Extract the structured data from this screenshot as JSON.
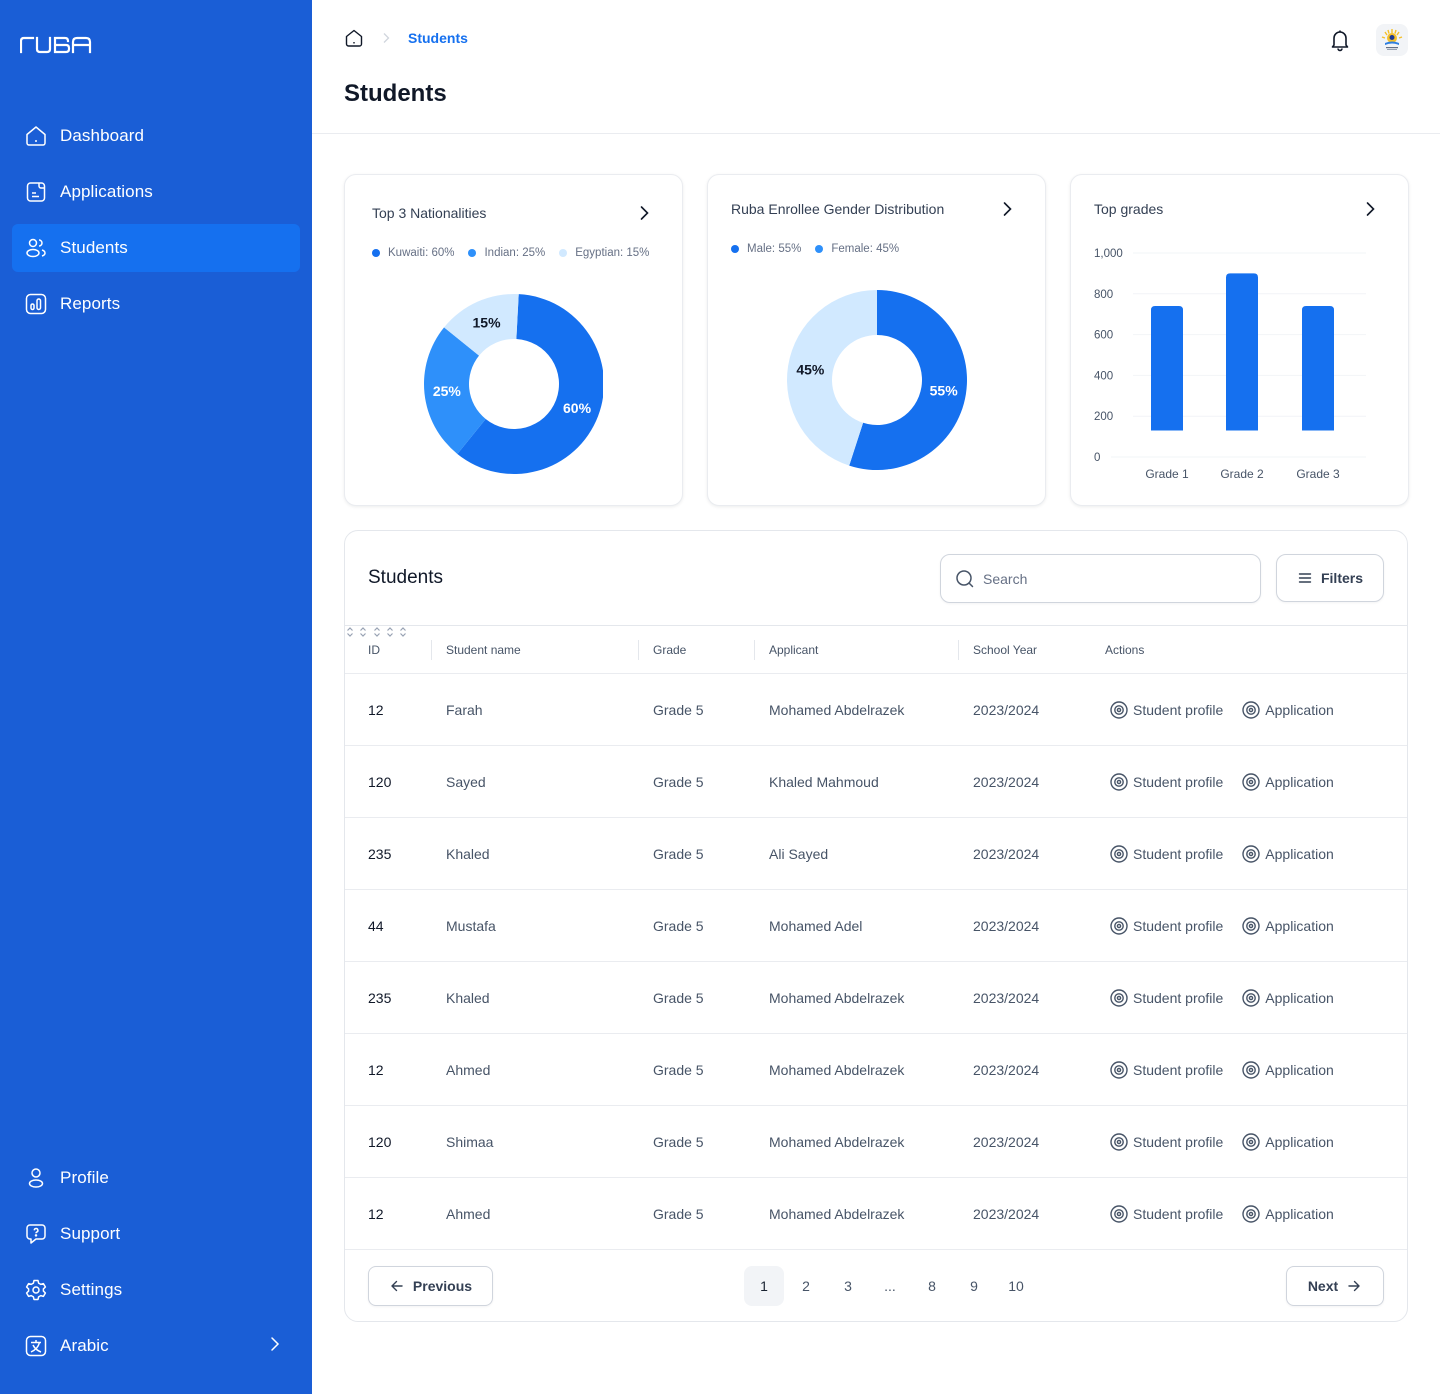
{
  "brand": {
    "logo_text": "ruba"
  },
  "sidebar": {
    "items": [
      {
        "label": "Dashboard",
        "icon": "home-icon",
        "active": false
      },
      {
        "label": "Applications",
        "icon": "document-icon",
        "active": false
      },
      {
        "label": "Students",
        "icon": "users-icon",
        "active": true
      },
      {
        "label": "Reports",
        "icon": "bar-chart-icon",
        "active": false
      }
    ],
    "bottom_items": [
      {
        "label": "Profile",
        "icon": "user-icon"
      },
      {
        "label": "Support",
        "icon": "help-message-icon"
      },
      {
        "label": "Settings",
        "icon": "gear-icon"
      },
      {
        "label": "Arabic",
        "icon": "translate-icon"
      }
    ],
    "colors": {
      "background": "#1a5ed6",
      "active": "#1570ef"
    }
  },
  "header": {
    "breadcrumb": {
      "home_icon": "home-icon",
      "current": "Students"
    },
    "title": "Students",
    "notification_icon": "bell-icon",
    "avatar_alt": "School logo"
  },
  "cards": {
    "nationalities": {
      "title": "Top 3 Nationalities",
      "legend": [
        "Kuwaiti: 60%",
        "Indian: 25%",
        "Egyptian: 15%"
      ]
    },
    "gender": {
      "title": "Ruba Enrollee Gender Distribution",
      "legend": [
        "Male: 55%",
        "Female: 45%"
      ]
    },
    "grades": {
      "title": "Top grades"
    }
  },
  "chart_data": [
    {
      "type": "pie",
      "title": "Top 3 Nationalities",
      "categories": [
        "Kuwaiti",
        "Indian",
        "Egyptian"
      ],
      "values": [
        60,
        25,
        15
      ],
      "labels": [
        "60%",
        "25%",
        "15%"
      ],
      "colors": [
        "#1570ef",
        "#2e90fa",
        "#d1e9ff"
      ],
      "donut": true,
      "legend_position": "top-left"
    },
    {
      "type": "pie",
      "title": "Ruba Enrollee Gender Distribution",
      "categories": [
        "Male",
        "Female"
      ],
      "values": [
        55,
        45
      ],
      "labels": [
        "55%",
        "45%"
      ],
      "colors": [
        "#1570ef",
        "#d1e9ff"
      ],
      "legend_colors": [
        "#1570ef",
        "#2e90fa"
      ],
      "donut": true,
      "legend_position": "top-left"
    },
    {
      "type": "bar",
      "title": "Top grades",
      "categories": [
        "Grade 1",
        "Grade 2",
        "Grade 3"
      ],
      "values": [
        740,
        900,
        740
      ],
      "baseline": 130,
      "xlabel": "",
      "ylabel": "",
      "ylim": [
        0,
        1000
      ],
      "yticks": [
        "0",
        "200",
        "400",
        "600",
        "800",
        "1,000"
      ],
      "grid": true,
      "color": "#1570ef"
    }
  ],
  "table": {
    "title": "Students",
    "search": {
      "placeholder": "Search",
      "value": ""
    },
    "filters_label": "Filters",
    "columns": [
      "ID",
      "Student name",
      "Grade",
      "Applicant",
      "School Year",
      "Actions"
    ],
    "action_labels": {
      "profile": "Student profile",
      "application": "Application"
    },
    "rows": [
      {
        "id": "12",
        "name": "Farah",
        "grade": "Grade 5",
        "applicant": "Mohamed Abdelrazek",
        "year": "2023/2024"
      },
      {
        "id": "120",
        "name": "Sayed",
        "grade": "Grade 5",
        "applicant": "Khaled Mahmoud",
        "year": "2023/2024"
      },
      {
        "id": "235",
        "name": "Khaled",
        "grade": "Grade 5",
        "applicant": "Ali Sayed",
        "year": "2023/2024"
      },
      {
        "id": "44",
        "name": "Mustafa",
        "grade": "Grade 5",
        "applicant": "Mohamed Adel",
        "year": "2023/2024"
      },
      {
        "id": "235",
        "name": "Khaled",
        "grade": "Grade 5",
        "applicant": "Mohamed Abdelrazek",
        "year": "2023/2024"
      },
      {
        "id": "12",
        "name": "Ahmed",
        "grade": "Grade 5",
        "applicant": "Mohamed Abdelrazek",
        "year": "2023/2024"
      },
      {
        "id": "120",
        "name": "Shimaa",
        "grade": "Grade 5",
        "applicant": "Mohamed Abdelrazek",
        "year": "2023/2024"
      },
      {
        "id": "12",
        "name": "Ahmed",
        "grade": "Grade 5",
        "applicant": "Mohamed Abdelrazek",
        "year": "2023/2024"
      }
    ]
  },
  "pagination": {
    "previous_label": "Previous",
    "next_label": "Next",
    "pages": [
      "1",
      "2",
      "3",
      "...",
      "8",
      "9",
      "10"
    ],
    "current": "1"
  }
}
